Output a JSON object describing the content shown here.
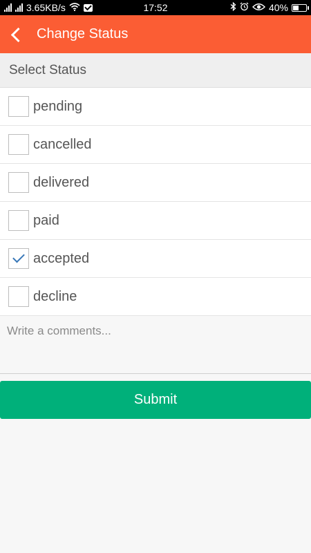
{
  "status_bar": {
    "network_speed": "3.65KB/s",
    "time": "17:52",
    "battery": "40%",
    "battery_level": 0.4
  },
  "header": {
    "title": "Change Status",
    "back_icon": "back-arrow-icon",
    "background_color": "#fb5d34"
  },
  "section": {
    "title": "Select Status"
  },
  "options": [
    {
      "label": "pending",
      "checked": false
    },
    {
      "label": "cancelled",
      "checked": false
    },
    {
      "label": "delivered",
      "checked": false
    },
    {
      "label": "paid",
      "checked": false
    },
    {
      "label": "accepted",
      "checked": true
    },
    {
      "label": "decline",
      "checked": false
    }
  ],
  "comment": {
    "placeholder": "Write a comments...",
    "value": ""
  },
  "submit": {
    "label": "Submit",
    "background_color": "#00b07a"
  }
}
